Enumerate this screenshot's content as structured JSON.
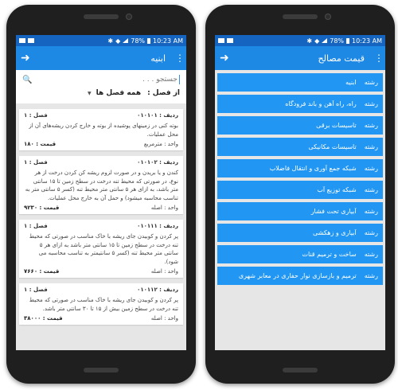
{
  "status": {
    "battery": "78%",
    "time": "10:23 AM"
  },
  "left": {
    "title": "ابنیه",
    "search_placeholder": "جستجو . . .",
    "season_label": "از فصل :",
    "season_value": "همه فصل ها",
    "cards": [
      {
        "chapter": "فصل : ۱",
        "row": "ردیف : ۰۱۰۱۰۱",
        "desc": "بوته کنی در زمینهای پوشیده از بوته و خارج کردن ریشه‌های آن از محل عملیات.",
        "unit": "واحد : مترمربع",
        "price": "قیمت : ۱۸۰"
      },
      {
        "chapter": "فصل : ۱",
        "row": "ردیف : ۰۱۰۱۰۲",
        "desc": "کندن و یا بریدن و در صورت لزوم ریشه کن کردن درخت از هر نوع، در صورتی که محیط تنه درخت در سطح زمین تا ۱۵ سانتی متر باشد، به ازای هر ۵ سانتی متر محیط تنه (کسر ۵ سانتی متر به تناسب محاسبه میشود) و حمل آن به خارج محل عملیات.",
        "unit": "واحد : اصله",
        "price": "قیمت : ۹۲۳۰"
      },
      {
        "chapter": "فصل : ۱",
        "row": "ردیف : ۰۱۰۱۱۱",
        "desc": "پر کردن و کوبیدن جای ریشه با خاک مناسب در صورتی که محیط تنه درخت در سطح زمین تا ۱۵ سانتی متر باشد به ازای هر ۵ سانتی متر محیط تنه (کسر ۵ سانتیمتر به تناسب محاسبه می شود).",
        "unit": "واحد : اصله",
        "price": "قیمت : ۷۶۶۰"
      },
      {
        "chapter": "فصل : ۱",
        "row": "ردیف : ۰۱۰۱۱۲",
        "desc": "پر کردن و کوبیدن جای ریشه با خاک مناسب در صورتی که محیط تنه درخت در سطح زمین بیش از ۱۵ تا ۳۰ سانتی متر باشد.",
        "unit": "واحد : اصله",
        "price": "قیمت : ۳۸۰۰۰"
      }
    ]
  },
  "right": {
    "title": "قیمت مصالح",
    "prefix": "رشته",
    "items": [
      "ابنیه",
      "راه، راه آهن و باند فرودگاه",
      "تاسیسات برقی",
      "تاسیسات مکانیکی",
      "شبکه جمع آوری و انتقال فاضلاب",
      "شبکه توزیع آب",
      "آبیاری تحت فشار",
      "آبیاری و زهکشی",
      "ساخت و ترمیم قنات",
      "ترمیم و بازسازی نوار حفاری در معابر شهری"
    ]
  }
}
